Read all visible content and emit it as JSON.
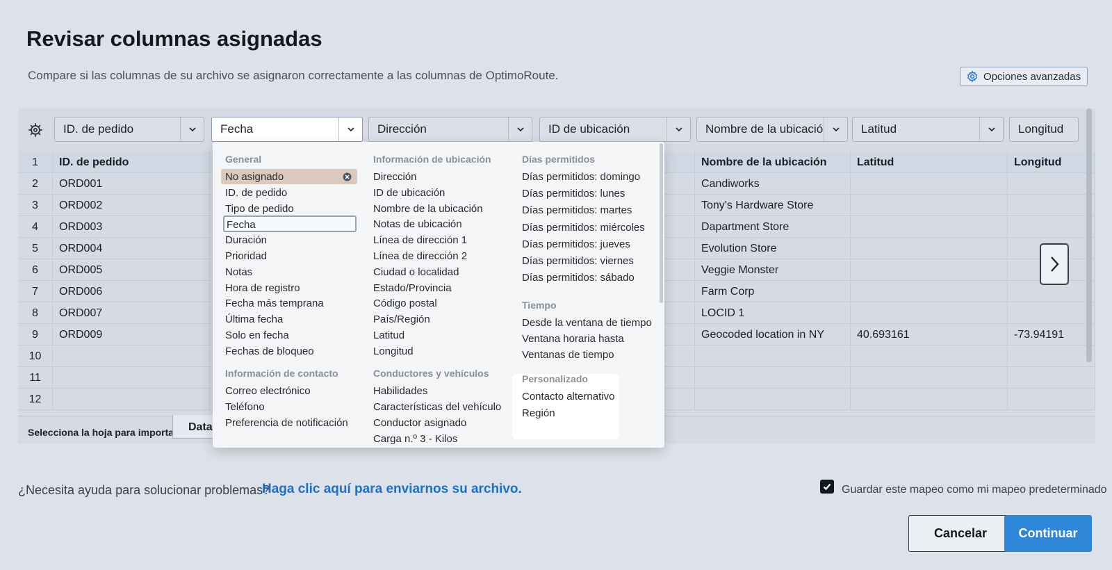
{
  "header": {
    "title": "Revisar columnas asignadas",
    "subtitle": "Compare si las columnas de su archivo se asignaron correctamente a las columnas de OptimoRoute.",
    "advanced_label": "Opciones avanzadas"
  },
  "column_selectors": [
    "ID. de pedido",
    "Fecha",
    "Dirección",
    "ID de ubicación",
    "Nombre de la ubicación",
    "Latitud",
    "Longitud"
  ],
  "table": {
    "header_row": {
      "num": "1",
      "c1": "ID. de pedido",
      "c5": "Nombre de la ubicación",
      "c6": "Latitud",
      "c7": "Longitud"
    },
    "rows": [
      {
        "num": "2",
        "c1": "ORD001",
        "c5": "Candiworks",
        "c6": "",
        "c7": ""
      },
      {
        "num": "3",
        "c1": "ORD002",
        "c5": "Tony's Hardware Store",
        "c6": "",
        "c7": ""
      },
      {
        "num": "4",
        "c1": "ORD003",
        "c5": "Dapartment Store",
        "c6": "",
        "c7": ""
      },
      {
        "num": "5",
        "c1": "ORD004",
        "c5": "Evolution Store",
        "c6": "",
        "c7": ""
      },
      {
        "num": "6",
        "c1": "ORD005",
        "c5": "Veggie Monster",
        "c6": "",
        "c7": ""
      },
      {
        "num": "7",
        "c1": "ORD006",
        "c5": "Farm Corp",
        "c6": "",
        "c7": ""
      },
      {
        "num": "8",
        "c1": "ORD007",
        "c5": "LOCID 1",
        "c6": "",
        "c7": ""
      },
      {
        "num": "9",
        "c1": "ORD009",
        "c5": "Geocoded location in NY",
        "c6": "40.693161",
        "c7": "-73.94191"
      },
      {
        "num": "10",
        "c1": "",
        "c5": "",
        "c6": "",
        "c7": ""
      },
      {
        "num": "11",
        "c1": "",
        "c5": "",
        "c6": "",
        "c7": ""
      },
      {
        "num": "12",
        "c1": "",
        "c5": "",
        "c6": "",
        "c7": ""
      }
    ]
  },
  "sheet": {
    "label": "Selecciona la hoja para importar:",
    "tab": "Data"
  },
  "dropdown": {
    "general": {
      "heading": "General",
      "items": [
        "No asignado",
        "ID. de pedido",
        "Tipo de pedido",
        "Fecha",
        "Duración",
        "Prioridad",
        "Notas",
        "Hora de registro",
        "Fecha más temprana",
        "Última fecha",
        "Solo en fecha",
        "Fechas de bloqueo"
      ]
    },
    "contact": {
      "heading": "Información de contacto",
      "items": [
        "Correo electrónico",
        "Teléfono",
        "Preferencia de notificación"
      ]
    },
    "location": {
      "heading": "Información de ubicación",
      "items": [
        "Dirección",
        "ID de ubicación",
        "Nombre de la ubicación",
        "Notas de ubicación",
        "Línea de dirección 1",
        "Línea de dirección 2",
        "Ciudad o localidad",
        "Estado/Provincia",
        "Código postal",
        "País/Región",
        "Latitud",
        "Longitud"
      ]
    },
    "drivers": {
      "heading": "Conductores y vehículos",
      "items": [
        "Habilidades",
        "Características del vehículo",
        "Conductor asignado",
        "Carga n.º 3 - Kilos"
      ]
    },
    "days": {
      "heading": "Días permitidos",
      "items": [
        "Días permitidos: domingo",
        "Días permitidos: lunes",
        "Días permitidos: martes",
        "Días permitidos: miércoles",
        "Días permitidos: jueves",
        "Días permitidos: viernes",
        "Días permitidos: sábado"
      ]
    },
    "time": {
      "heading": "Tiempo",
      "items": [
        "Desde la ventana de tiempo",
        "Ventana horaria hasta",
        "Ventanas de tiempo"
      ]
    },
    "custom": {
      "heading": "Personalizado",
      "items": [
        "Contacto alternativo",
        "Región"
      ]
    }
  },
  "footer": {
    "help_text": "¿Necesita ayuda para solucionar problemas?",
    "help_link": "Haga clic aquí para enviarnos su archivo.",
    "save_default_label": "Guardar este mapeo como mi mapeo predeterminado",
    "save_default_checked": true,
    "cancel_label": "Cancelar",
    "continue_label": "Continuar"
  },
  "colors": {
    "accent": "#2e86d8",
    "link": "#1f6fc4",
    "unassigned_highlight": "#dcc9bd"
  }
}
